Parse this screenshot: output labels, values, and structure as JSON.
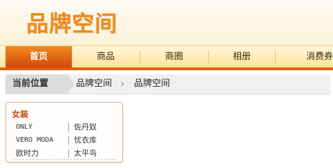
{
  "header": {
    "logo_text": "品牌空间"
  },
  "nav": {
    "items": [
      {
        "label": "首页",
        "active": true
      },
      {
        "label": "商品",
        "active": false
      },
      {
        "label": "商圈",
        "active": false
      },
      {
        "label": "相册",
        "active": false
      },
      {
        "label": "消费券",
        "active": false
      }
    ]
  },
  "breadcrumb": {
    "here_label": "当前位置",
    "items": [
      "品牌空间",
      "品牌空间"
    ]
  },
  "category": {
    "title": "女装",
    "rows": [
      [
        "ONLY",
        "佐丹奴"
      ],
      [
        "VERO MODA",
        "忧衣库"
      ],
      [
        "欧时力",
        "太平鸟"
      ]
    ]
  },
  "colors": {
    "accent": "#f18a1b",
    "nav_active": "#d3470c",
    "category_title": "#c2470e"
  }
}
